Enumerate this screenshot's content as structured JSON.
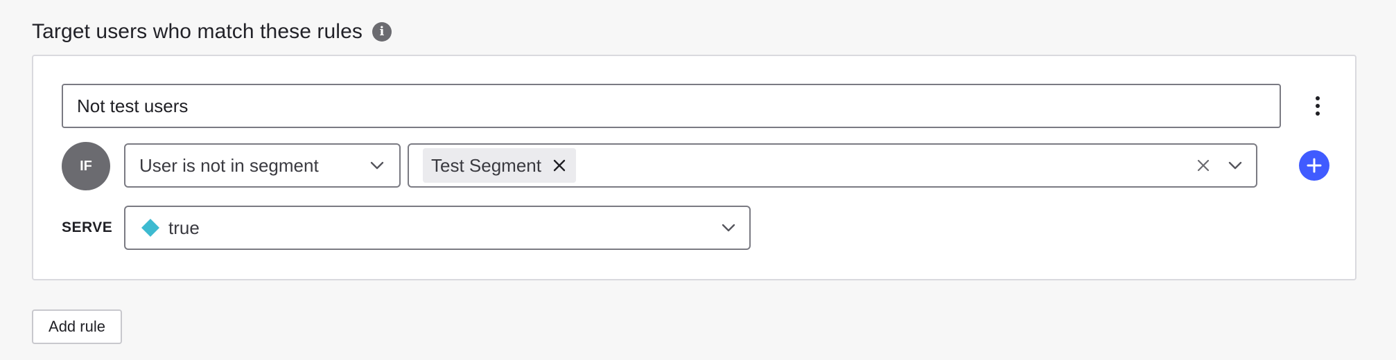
{
  "header": {
    "title": "Target users who match these rules",
    "info_icon": "info-icon"
  },
  "rule": {
    "name_value": "Not test users",
    "menu_icon": "kebab-menu-icon",
    "condition_badge": "IF",
    "operator": {
      "selected": "User is not in segment",
      "icon": "chevron-down-icon"
    },
    "values": {
      "chips": [
        "Test Segment"
      ],
      "chip_remove_icon": "close-icon",
      "clear_icon": "clear-icon",
      "dropdown_icon": "chevron-down-icon"
    },
    "add_clause_icon": "plus-circle-icon",
    "serve": {
      "label": "SERVE",
      "selected": "true",
      "variation_icon": "diamond-icon",
      "variation_color": "#3dbad0",
      "dropdown_icon": "chevron-down-icon"
    }
  },
  "actions": {
    "add_rule_label": "Add rule"
  },
  "colors": {
    "accent": "#405bff",
    "badge": "#6b6b70",
    "background": "#f7f7f7"
  }
}
